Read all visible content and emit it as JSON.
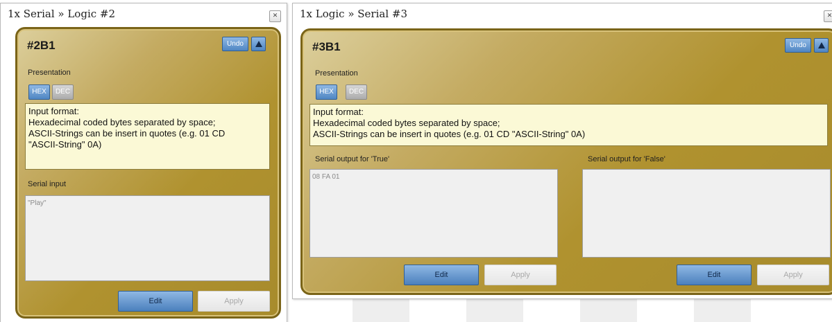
{
  "window1": {
    "title": "1x Serial » Logic #2",
    "close_glyph": "✕",
    "panel": {
      "id": "#2B1",
      "undo_label": "Undo",
      "collapse_icon": "triangle-up-icon",
      "presentation_label": "Presentation",
      "hex_label": "HEX",
      "dec_label": "DEC",
      "info_lines": [
        "Input format:",
        "Hexadecimal coded bytes separated by space;",
        "ASCII-Strings can be insert in quotes  (e.g. 01 CD",
        "\"ASCII-String\" 0A)"
      ],
      "serial_input_label": "Serial input",
      "serial_input_value": "\"Play\"",
      "edit_label": "Edit",
      "apply_label": "Apply"
    }
  },
  "window2": {
    "title": "1x Logic » Serial #3",
    "close_glyph": "✕",
    "panel": {
      "id": "#3B1",
      "undo_label": "Undo",
      "collapse_icon": "triangle-up-icon",
      "presentation_label": "Presentation",
      "hex_label": "HEX",
      "dec_label": "DEC",
      "info_lines": [
        "Input format:",
        "Hexadecimal coded bytes separated by space;",
        "ASCII-Strings can be insert in quotes  (e.g. 01 CD \"ASCII-String\" 0A)"
      ],
      "true_output_label": "Serial output for 'True'",
      "true_output_value": "08 FA 01",
      "false_output_label": "Serial output for 'False'",
      "false_output_value": "",
      "true_edit_label": "Edit",
      "true_apply_label": "Apply",
      "false_edit_label": "Edit",
      "false_apply_label": "Apply"
    }
  },
  "colors": {
    "panel_gold": "#b0922f",
    "panel_border": "#7a6418",
    "button_blue": "#4f86c3",
    "info_background": "#fbf9d6"
  }
}
